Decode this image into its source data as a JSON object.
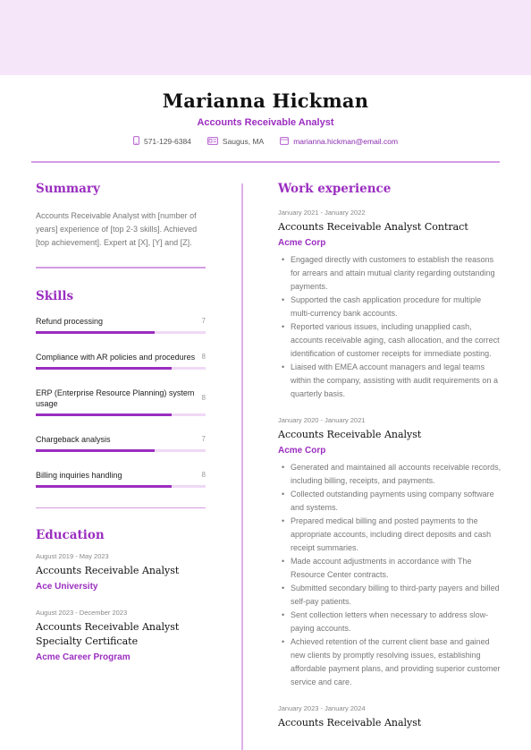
{
  "header": {
    "name": "Marianna Hickman",
    "title": "Accounts Receivable Analyst",
    "contacts": [
      {
        "icon": "phone-icon",
        "value": "571-129-6384"
      },
      {
        "icon": "location-icon",
        "value": "Saugus, MA"
      },
      {
        "icon": "email-icon",
        "value": "marianna.hickman@email.com"
      }
    ]
  },
  "summary": {
    "heading": "Summary",
    "text": "Accounts Receivable Analyst with [number of years] experience of [top 2-3 skills]. Achieved [top achievement]. Expert at [X], [Y] and [Z]."
  },
  "skills": {
    "heading": "Skills",
    "max": 10,
    "items": [
      {
        "name": "Refund processing",
        "level": "7",
        "value": 7
      },
      {
        "name": "Compliance with AR policies and procedures",
        "level": "8",
        "value": 8
      },
      {
        "name": "ERP (Enterprise Resource Planning) system usage",
        "level": "8",
        "value": 8
      },
      {
        "name": "Chargeback analysis",
        "level": "7",
        "value": 7
      },
      {
        "name": "Billing inquiries handling",
        "level": "8",
        "value": 8
      }
    ]
  },
  "education": {
    "heading": "Education",
    "items": [
      {
        "dates": "August 2019 - May 2023",
        "title": "Accounts Receivable Analyst",
        "org": "Ace University"
      },
      {
        "dates": "August 2023 - December 2023",
        "title": "Accounts Receivable Analyst Specialty Certificate",
        "org": "Acme Career Program"
      }
    ]
  },
  "work": {
    "heading": "Work experience",
    "items": [
      {
        "dates": "January 2021 - January 2022",
        "title": "Accounts Receivable Analyst Contract",
        "org": "Acme Corp",
        "bullets": [
          "Engaged directly with customers to establish the reasons for arrears and attain mutual clarity regarding outstanding payments.",
          "Supported the cash application procedure for multiple multi-currency bank accounts.",
          "Reported various issues, including unapplied cash, accounts receivable aging, cash allocation, and the correct identification of customer receipts for immediate posting.",
          "Liaised with EMEA account managers and legal teams within the company, assisting with audit requirements on a quarterly basis."
        ]
      },
      {
        "dates": "January 2020 - January 2021",
        "title": "Accounts Receivable Analyst",
        "org": "Acme Corp",
        "bullets": [
          "Generated and maintained all accounts receivable records, including billing, receipts, and payments.",
          "Collected outstanding payments using company software and systems.",
          "Prepared medical billing and posted payments to the appropriate accounts, including direct deposits and cash receipt summaries.",
          "Made account adjustments in accordance with The Resource Center contracts.",
          "Submitted secondary billing to third-party payers and billed self-pay patients.",
          "Sent collection letters when necessary to address slow-paying accounts.",
          "Achieved retention of the current client base and gained new clients by promptly resolving issues, establishing affordable payment plans, and providing superior customer service and care."
        ]
      },
      {
        "dates": "January 2023 - January 2024",
        "title": "Accounts Receivable Analyst",
        "org": "",
        "bullets": []
      }
    ]
  },
  "colors": {
    "accent": "#9b2ec0",
    "band": "#f6e6fa",
    "rule": "#d59ce4",
    "bar_track": "#f0d9f5"
  }
}
